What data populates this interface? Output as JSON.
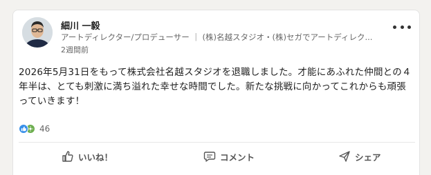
{
  "author": {
    "name": "細川 一毅",
    "headline": "アートディレクター/プロデューサー ｜ (株)名越スタジオ・(株)セガでアートディレク...",
    "time": "2週間前"
  },
  "post": {
    "text": "2026年5月31日をもって株式会社名越スタジオを退職しました。才能にあふれた仲間との４年半は、とても刺激に満ち溢れた幸せな時間でした。新たな挑戦に向かってこれからも頑張っていきます！"
  },
  "reactions": {
    "icons": [
      "like-icon",
      "celebrate-icon"
    ],
    "count": "46"
  },
  "actions": {
    "like_label": "いいね！",
    "comment_label": "コメント",
    "share_label": "シェア"
  },
  "colors": {
    "like": "#378fe9",
    "celebrate": "#6dae4f",
    "text": "#1f1f1f",
    "muted": "#666666"
  }
}
